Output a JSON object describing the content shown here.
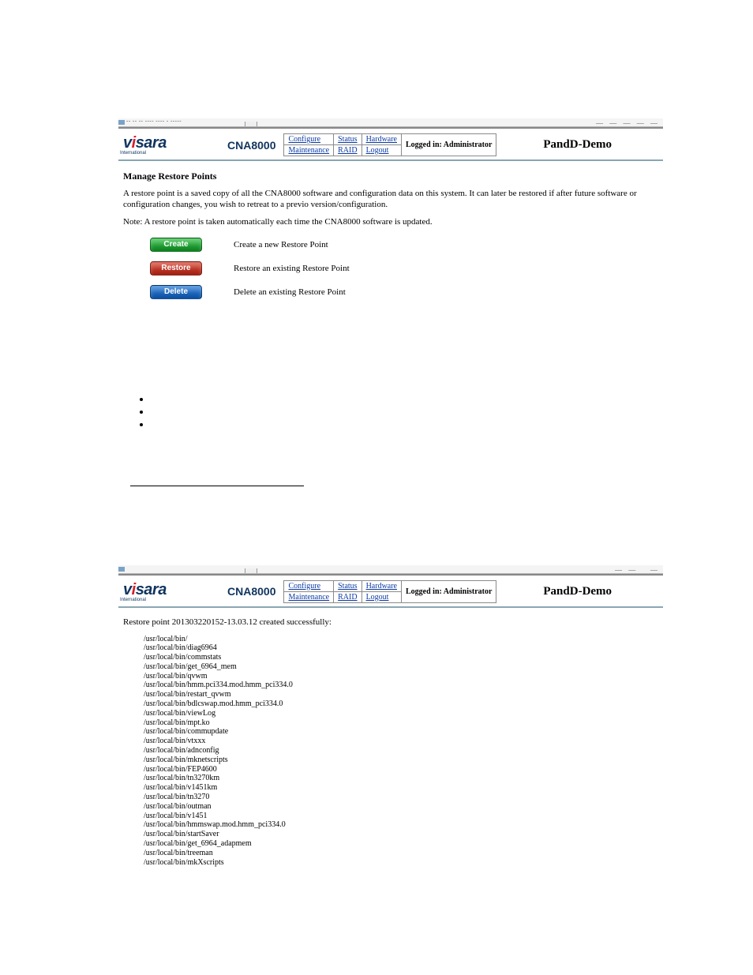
{
  "screenshot1": {
    "window": {
      "titleFragment": "-- -- -- ---- ---- - -----",
      "rightDashes": "— — —  — —"
    },
    "header": {
      "brand_v": "v",
      "brand_rest": "sara",
      "brand_i": "i",
      "brand_sub": "International",
      "product": "CNA8000",
      "env": "PandD-Demo",
      "nav": {
        "r1c1": "Configure",
        "r1c2": "Status",
        "r1c3": "Hardware",
        "r2c1": "Maintenance",
        "r2c2": "RAID",
        "r2c3": "Logout",
        "status": "Logged in: Administrator"
      }
    },
    "page": {
      "title": "Manage Restore Points",
      "desc": "A restore point is a saved copy of all the CNA8000 software and configuration data on this system. It can later be restored if after future software or configuration changes, you wish to retreat to a previo version/configuration.",
      "note": "Note: A restore point is taken automatically each time the CNA8000 software is updated.",
      "actions": {
        "create": {
          "btn": "Create",
          "desc": "Create a new Restore Point"
        },
        "restore": {
          "btn": "Restore",
          "desc": "Restore an existing Restore Point"
        },
        "delete": {
          "btn": "Delete",
          "desc": "Delete an existing Restore Point"
        }
      }
    }
  },
  "midBullets": [
    "",
    "",
    ""
  ],
  "screenshot2": {
    "header": {
      "brand_v": "v",
      "brand_rest": "sara",
      "brand_i": "i",
      "brand_sub": "International",
      "product": "CNA8000",
      "env": "PandD-Demo",
      "nav": {
        "r1c1": "Configure",
        "r1c2": "Status",
        "r1c3": "Hardware",
        "r2c1": "Maintenance",
        "r2c2": "RAID",
        "r2c3": "Logout",
        "status": "Logged in: Administrator"
      }
    },
    "result": "Restore point 201303220152-13.03.12 created successfully:",
    "files": [
      "/usr/local/bin/",
      "/usr/local/bin/diag6964",
      "/usr/local/bin/commstats",
      "/usr/local/bin/get_6964_mem",
      "/usr/local/bin/qvwm",
      "/usr/local/bin/hmm.pci334.mod.hmm_pci334.0",
      "/usr/local/bin/restart_qvwm",
      "/usr/local/bin/bdlcswap.mod.hmm_pci334.0",
      "/usr/local/bin/viewLog",
      "/usr/local/bin/mpt.ko",
      "/usr/local/bin/commupdate",
      "/usr/local/bin/vtxxx",
      "/usr/local/bin/adnconfig",
      "/usr/local/bin/mknetscripts",
      "/usr/local/bin/FEP4600",
      "/usr/local/bin/tn3270km",
      "/usr/local/bin/v1451km",
      "/usr/local/bin/tn3270",
      "/usr/local/bin/outman",
      "/usr/local/bin/v1451",
      "/usr/local/bin/hmmswap.mod.hmm_pci334.0",
      "/usr/local/bin/startSaver",
      "/usr/local/bin/get_6964_adapmem",
      "/usr/local/bin/treeman",
      "/usr/local/bin/mkXscripts"
    ]
  }
}
